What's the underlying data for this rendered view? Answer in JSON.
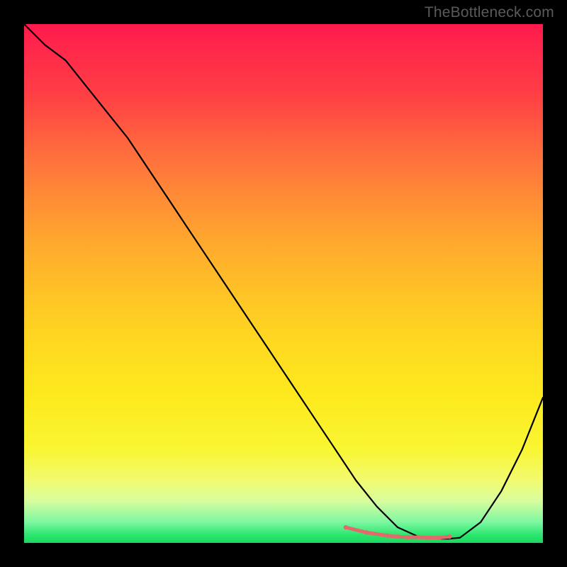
{
  "watermark": "TheBottleneck.com",
  "chart_data": {
    "type": "line",
    "title": "",
    "xlabel": "",
    "ylabel": "",
    "xlim": [
      0,
      100
    ],
    "ylim": [
      0,
      100
    ],
    "grid": false,
    "legend": false,
    "background_gradient": {
      "stops": [
        {
          "pos": 0,
          "color": "#ff1a4d"
        },
        {
          "pos": 50,
          "color": "#ffc326"
        },
        {
          "pos": 95,
          "color": "#ecfb70"
        },
        {
          "pos": 100,
          "color": "#1ad85f"
        }
      ]
    },
    "series": [
      {
        "name": "bottleneck-curve",
        "color": "#000000",
        "x": [
          0,
          4,
          8,
          12,
          16,
          20,
          24,
          28,
          32,
          36,
          40,
          44,
          48,
          52,
          56,
          60,
          64,
          68,
          72,
          76,
          80,
          82,
          84,
          88,
          92,
          96,
          100
        ],
        "values": [
          100,
          96,
          93,
          88,
          83,
          78,
          72,
          66,
          60,
          54,
          48,
          42,
          36,
          30,
          24,
          18,
          12,
          7,
          3,
          1.2,
          0.8,
          0.8,
          1.0,
          4,
          10,
          18,
          28
        ]
      }
    ],
    "scatter_overlay": {
      "name": "highlight-points",
      "color": "#e36a6a",
      "x": [
        62,
        66,
        70,
        72,
        74,
        76,
        78,
        80,
        82
      ],
      "values": [
        3,
        2,
        1.4,
        1.2,
        1.1,
        1.1,
        1.0,
        1.0,
        1.2
      ]
    }
  }
}
